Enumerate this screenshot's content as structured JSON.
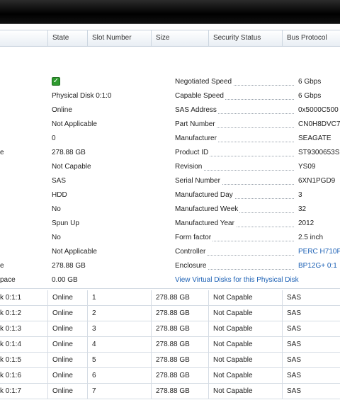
{
  "header": {
    "columns": [
      "State",
      "Slot Number",
      "Size",
      "Security Status",
      "Bus Protocol"
    ]
  },
  "detail": {
    "left_labels": [
      "",
      "",
      "",
      "",
      "",
      "e",
      "",
      "",
      "",
      "",
      "",
      "",
      "",
      "e",
      "pace"
    ],
    "left_values": [
      "Physical Disk 0:1:0",
      "Online",
      "Not Applicable",
      "0",
      "278.88 GB",
      "Not Capable",
      "SAS",
      "HDD",
      "No",
      "Spun Up",
      "No",
      "Not Applicable",
      "278.88 GB",
      "0.00 GB"
    ],
    "status_icon": "check-icon",
    "status_color": "#2e9a2e",
    "right": [
      {
        "key": "Negotiated Speed",
        "value": "6 Gbps",
        "link": false
      },
      {
        "key": "Capable Speed",
        "value": "6 Gbps",
        "link": false
      },
      {
        "key": "SAS Address",
        "value": "0x5000C500",
        "link": false
      },
      {
        "key": "Part Number",
        "value": "CN0H8DVC7",
        "link": false
      },
      {
        "key": "Manufacturer",
        "value": "SEAGATE",
        "link": false
      },
      {
        "key": "Product ID",
        "value": "ST9300653S",
        "link": false
      },
      {
        "key": "Revision",
        "value": "YS09",
        "link": false
      },
      {
        "key": "Serial Number",
        "value": "6XN1PGD9",
        "link": false
      },
      {
        "key": "Manufactured Day",
        "value": "3",
        "link": false
      },
      {
        "key": "Manufactured Week",
        "value": "32",
        "link": false
      },
      {
        "key": "Manufactured Year",
        "value": "2012",
        "link": false
      },
      {
        "key": "Form factor",
        "value": "2.5 inch",
        "link": false
      },
      {
        "key": "Controller",
        "value": "PERC H710F",
        "link": true
      },
      {
        "key": "Enclosure",
        "value": "BP12G+ 0:1",
        "link": true
      }
    ],
    "view_link": "View Virtual Disks for this Physical Disk"
  },
  "disks": [
    {
      "name": "k 0:1:1",
      "state": "Online",
      "slot": "1",
      "size": "278.88 GB",
      "security": "Not Capable",
      "bus": "SAS"
    },
    {
      "name": "k 0:1:2",
      "state": "Online",
      "slot": "2",
      "size": "278.88 GB",
      "security": "Not Capable",
      "bus": "SAS"
    },
    {
      "name": "k 0:1:3",
      "state": "Online",
      "slot": "3",
      "size": "278.88 GB",
      "security": "Not Capable",
      "bus": "SAS"
    },
    {
      "name": "k 0:1:4",
      "state": "Online",
      "slot": "4",
      "size": "278.88 GB",
      "security": "Not Capable",
      "bus": "SAS"
    },
    {
      "name": "k 0:1:5",
      "state": "Online",
      "slot": "5",
      "size": "278.88 GB",
      "security": "Not Capable",
      "bus": "SAS"
    },
    {
      "name": "k 0:1:6",
      "state": "Online",
      "slot": "6",
      "size": "278.88 GB",
      "security": "Not Capable",
      "bus": "SAS"
    },
    {
      "name": "k 0:1:7",
      "state": "Online",
      "slot": "7",
      "size": "278.88 GB",
      "security": "Not Capable",
      "bus": "SAS"
    }
  ]
}
